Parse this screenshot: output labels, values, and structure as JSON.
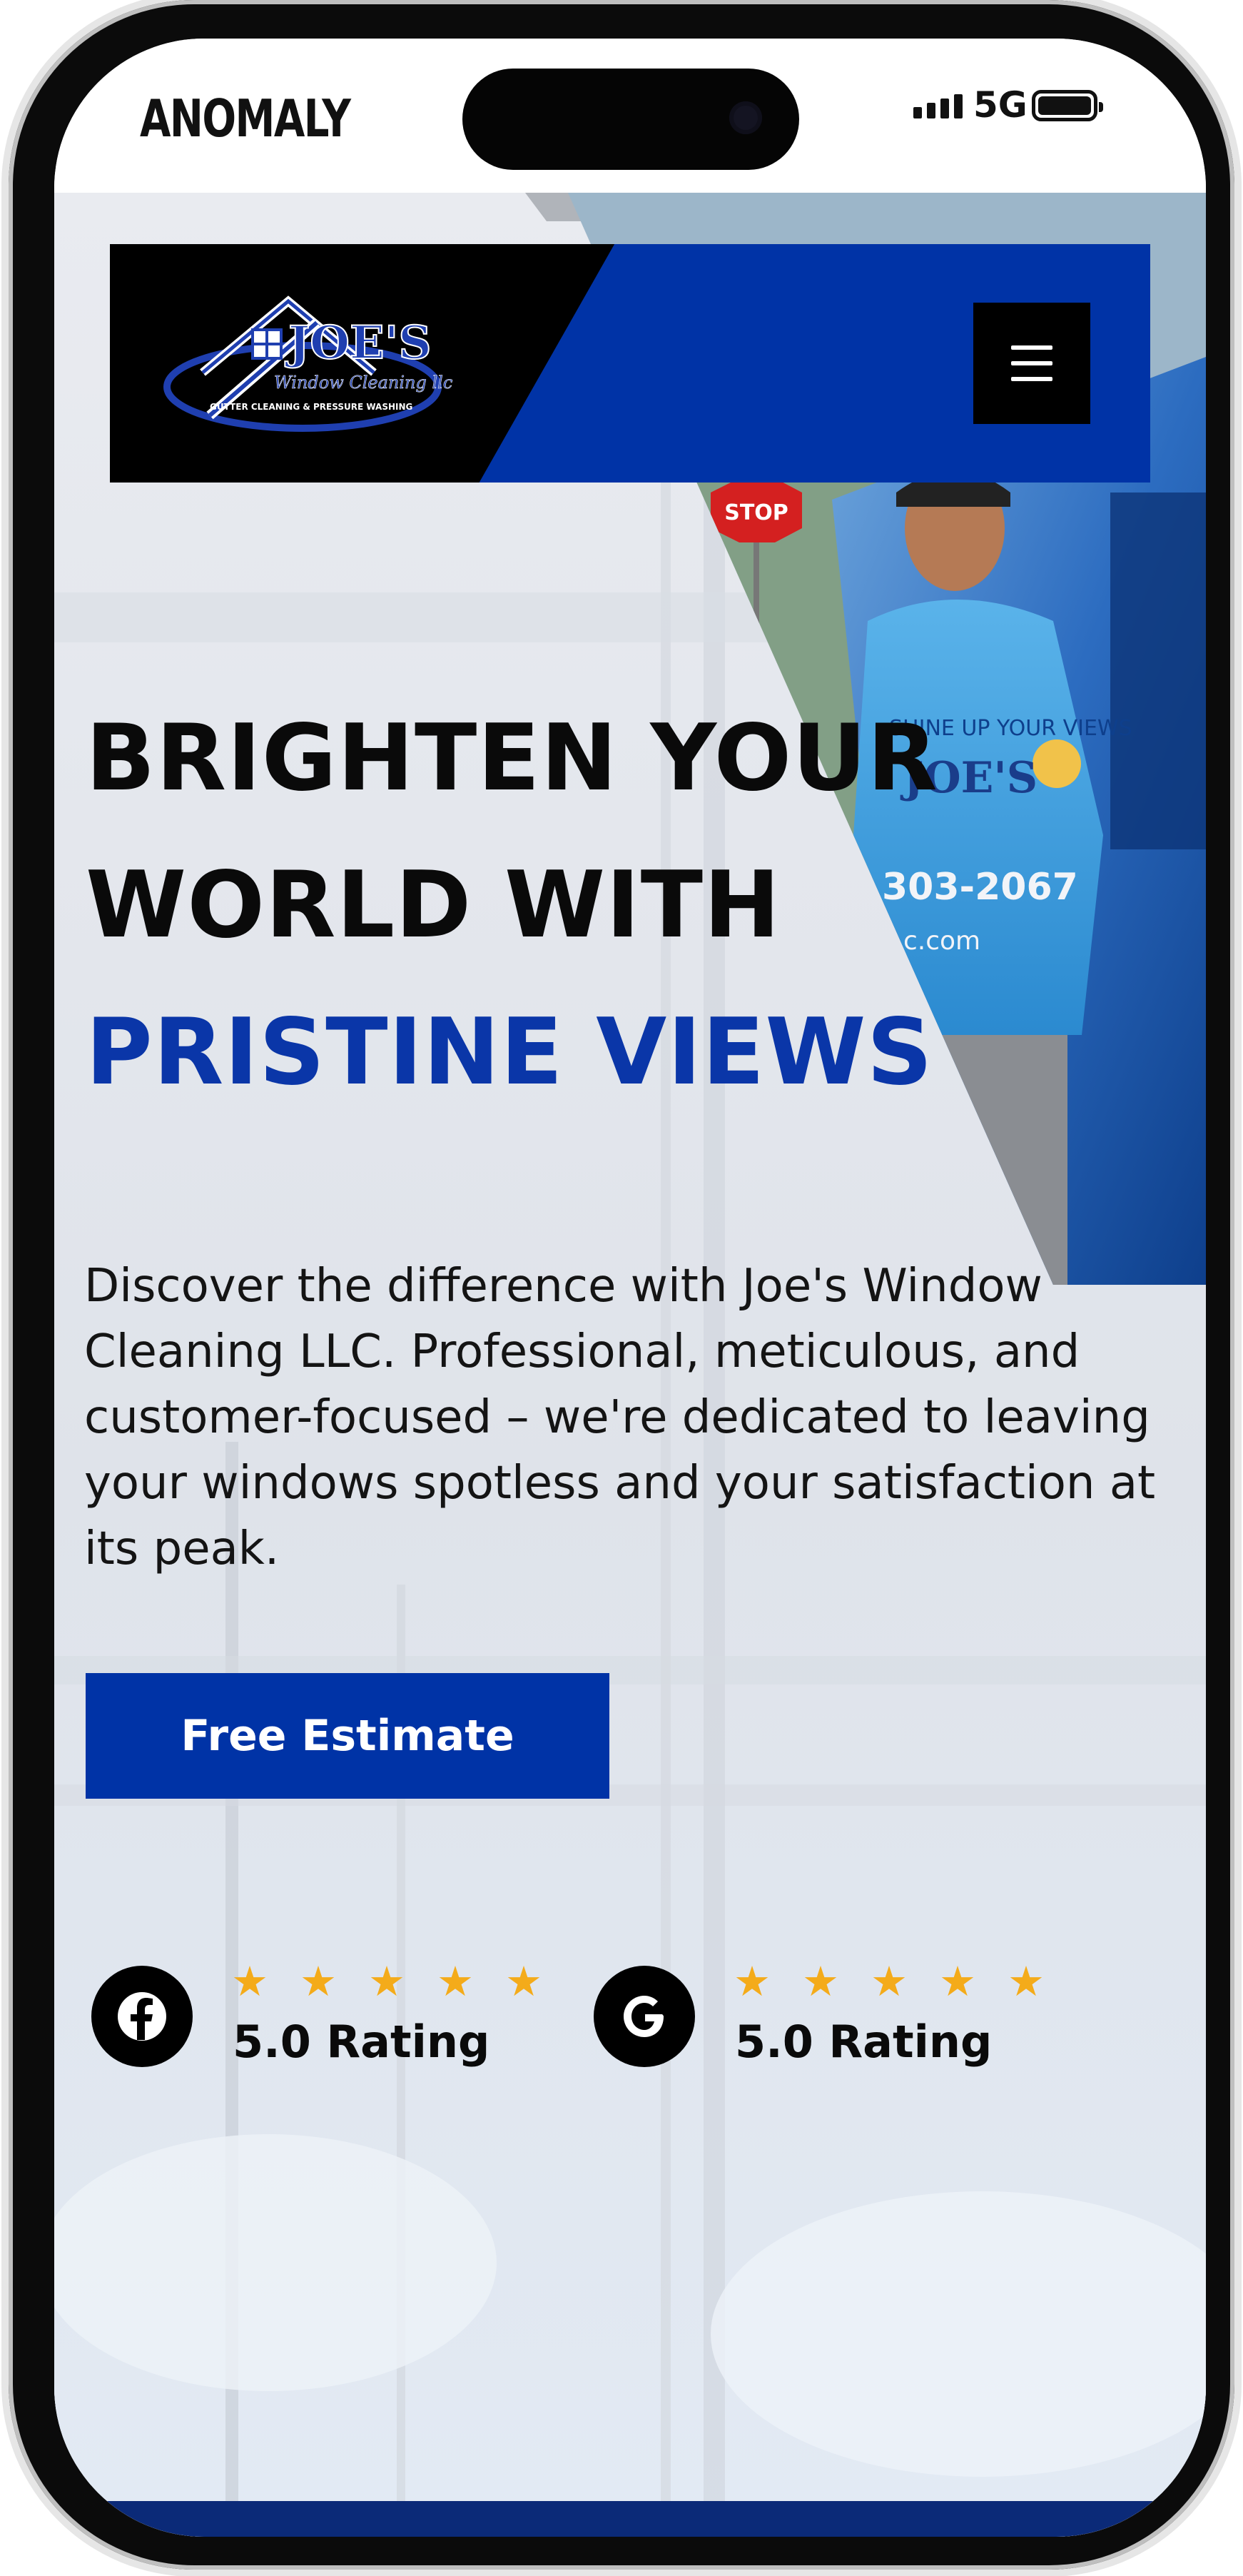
{
  "status_bar": {
    "carrier": "ANOMALY",
    "network": "5G"
  },
  "header": {
    "logo": {
      "name": "JOE'S",
      "subtitle": "Window Cleaning llc",
      "tagline": "GUTTER CLEANING & PRESSURE WASHING"
    },
    "menu_icon": "hamburger-icon"
  },
  "hero": {
    "headline_line1": "BRIGHTEN YOUR",
    "headline_line2": "WORLD WITH",
    "headline_line3": "PRISTINE VIEWS",
    "description": "Discover the difference with Joe's Window Cleaning LLC. Professional, meticulous, and customer-focused – we're dedicated to leaving your windows spotless and your satisfaction at its peak.",
    "cta_label": "Free Estimate",
    "photo_texts": {
      "sign": "STOP",
      "shirt_top": "SHINE UP YOUR VIEWS",
      "shirt_brand": "JOE'S",
      "shirt_phone": "303-2067",
      "shirt_web": "c.com"
    }
  },
  "ratings": [
    {
      "platform": "Facebook",
      "icon": "facebook-icon",
      "stars": 5,
      "label": "5.0 Rating"
    },
    {
      "platform": "Google",
      "icon": "google-icon",
      "stars": 5,
      "label": "5.0 Rating"
    }
  ],
  "colors": {
    "brand_blue": "#0033a6",
    "star": "#f4ab1a",
    "text": "#0a0a0a"
  }
}
